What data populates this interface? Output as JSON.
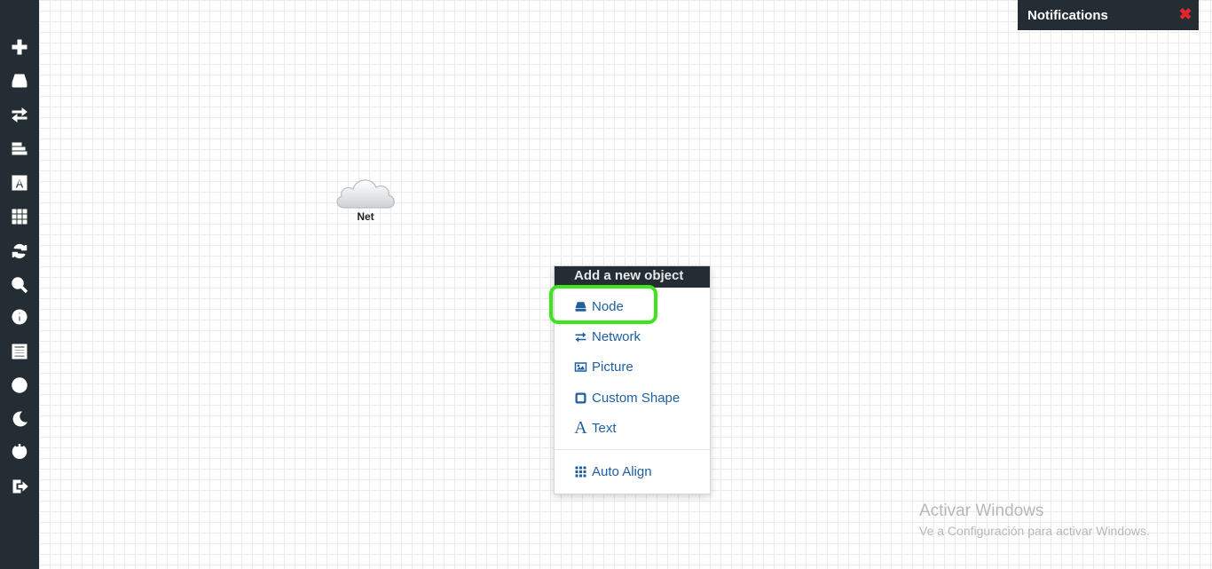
{
  "sidebar": {
    "items": [
      {
        "name": "add-icon"
      },
      {
        "name": "node-icon"
      },
      {
        "name": "network-icon"
      },
      {
        "name": "align-icon"
      },
      {
        "name": "text-icon"
      },
      {
        "name": "grid-icon"
      },
      {
        "name": "refresh-icon"
      },
      {
        "name": "zoom-icon"
      },
      {
        "name": "info-icon"
      },
      {
        "name": "list-icon"
      },
      {
        "name": "check-icon"
      },
      {
        "name": "moon-icon"
      },
      {
        "name": "power-icon"
      },
      {
        "name": "logout-icon"
      }
    ]
  },
  "notifications": {
    "title": "Notifications",
    "close_glyph": "✖"
  },
  "canvas": {
    "network_node_label": "Net"
  },
  "context_menu": {
    "header": "Add a new object",
    "items": [
      {
        "label": "Node",
        "icon": "node-icon"
      },
      {
        "label": "Network",
        "icon": "network-icon"
      },
      {
        "label": "Picture",
        "icon": "picture-icon"
      },
      {
        "label": "Custom Shape",
        "icon": "custom-shape-icon"
      },
      {
        "label": "Text",
        "icon": "text-icon"
      },
      {
        "label": "Auto Align",
        "icon": "grid-icon"
      }
    ]
  },
  "watermark": {
    "title": "Activar Windows",
    "subtitle": "Ve a Configuración para activar Windows."
  },
  "colors": {
    "sidebar_bg": "#232d33",
    "menu_link": "#1f5fa0",
    "highlight": "#3fe51b",
    "close_red": "#e3262c"
  }
}
